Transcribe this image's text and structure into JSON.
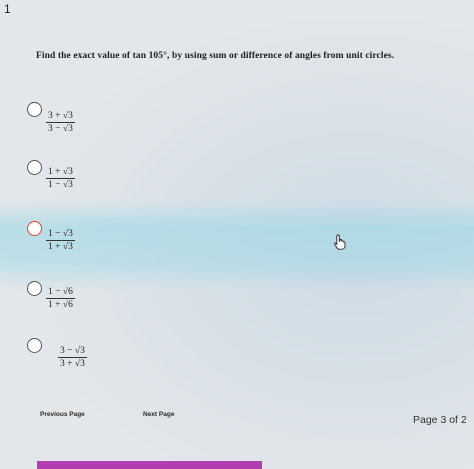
{
  "question_number": "1",
  "question_text": "Find the exact value of tan 105°, by using sum or difference of angles from unit circles.",
  "options": [
    {
      "numerator": "3 + √3",
      "denominator": "3 − √3",
      "selected": false
    },
    {
      "numerator": "1 + √3",
      "denominator": "1 − √3",
      "selected": false
    },
    {
      "numerator": "1 − √3",
      "denominator": "1 + √3",
      "selected": true
    },
    {
      "numerator": "1 − √6",
      "denominator": "1 + √6",
      "selected": false
    },
    {
      "numerator": "3 − √3",
      "denominator": "3 + √3",
      "selected": false
    }
  ],
  "nav": {
    "previous_label": "Previous Page",
    "next_label": "Next Page"
  },
  "page_indicator": "Page 3 of 2",
  "colors": {
    "selected_radio": "#e0422c",
    "bottom_bar": "#b03eb0"
  },
  "icons": {
    "cursor": "hand-pointer-icon"
  }
}
